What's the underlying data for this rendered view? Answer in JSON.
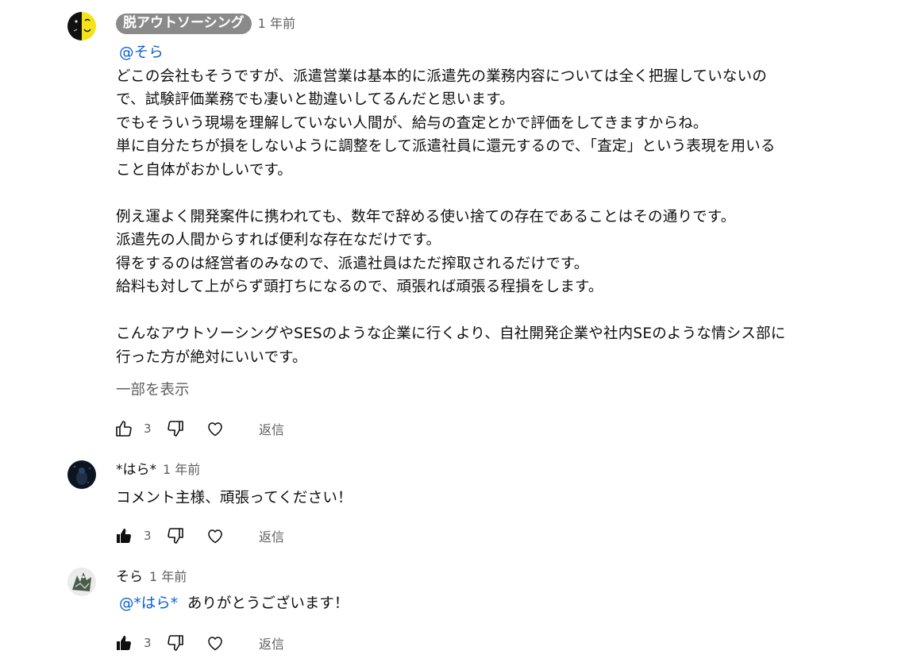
{
  "comments": [
    {
      "author": "脱アウトソーシング",
      "time": "1 年前",
      "mention": "@そら",
      "paragraphs": [
        [
          "どこの会社もそうですが、派遣営業は基本的に派遣先の業務内容については全く把握していないの",
          "で、試験評価業務でも凄いと勘違いしてるんだと思います。",
          "でもそういう現場を理解していない人間が、給与の査定とかで評価をしてきますからね。",
          "単に自分たちが損をしないように調整をして派遣社員に還元するので、「査定」という表現を用いる",
          "こと自体がおかしいです。"
        ],
        [
          "例え運よく開発案件に携われても、数年で辞める使い捨ての存在であることはその通りです。",
          "派遣先の人間からすれば便利な存在なだけです。",
          "得をするのは経営者のみなので、派遣社員はただ搾取されるだけです。",
          "給料も対して上がらず頭打ちになるので、頑張れば頑張る程損をします。"
        ],
        [
          "こんなアウトソーシングやSESのような企業に行くより、自社開発企業や社内SEのような情シス部に",
          "行った方が絶対にいいです。"
        ]
      ],
      "show_more": "一部を表示",
      "likes": "3",
      "reply_label": "返信",
      "liked": false
    },
    {
      "author": "*はら*",
      "time": "1 年前",
      "text": "コメント主様、頑張ってください！",
      "likes": "3",
      "reply_label": "返信",
      "liked": true
    },
    {
      "author": "そら",
      "time": "1 年前",
      "mention": "@*はら*",
      "text": "ありがとうございます！",
      "likes": "3",
      "reply_label": "返信",
      "liked": true
    }
  ],
  "colors": {
    "text": "#0f0f0f",
    "secondary": "#606060",
    "mention": "#065fd4",
    "author_chip_bg": "#8a8a8a"
  },
  "icons": {
    "like": "thumbs-up-icon",
    "dislike": "thumbs-down-icon",
    "heart": "heart-icon"
  }
}
